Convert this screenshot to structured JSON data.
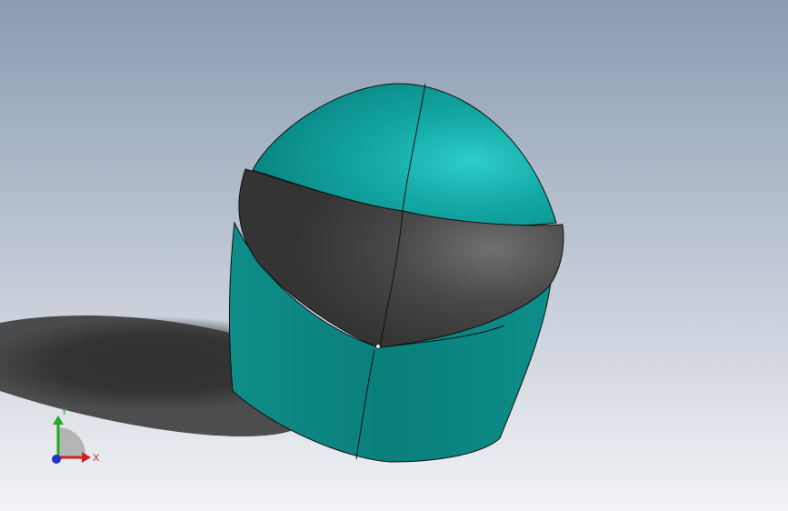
{
  "viewport": {
    "background_top": "#8a9bb2",
    "background_bottom": "#f2f3f5"
  },
  "model": {
    "body_color": "#0e8f8c",
    "body_highlight": "#25c4c0",
    "visor_color": "#3d3d3d",
    "visor_highlight": "#6e6e6e",
    "edge_color": "#111111"
  },
  "triad": {
    "x_label": "X",
    "y_label": "Y",
    "x_color": "#cc2222",
    "y_color": "#22aa22",
    "z_color": "#2233cc"
  }
}
